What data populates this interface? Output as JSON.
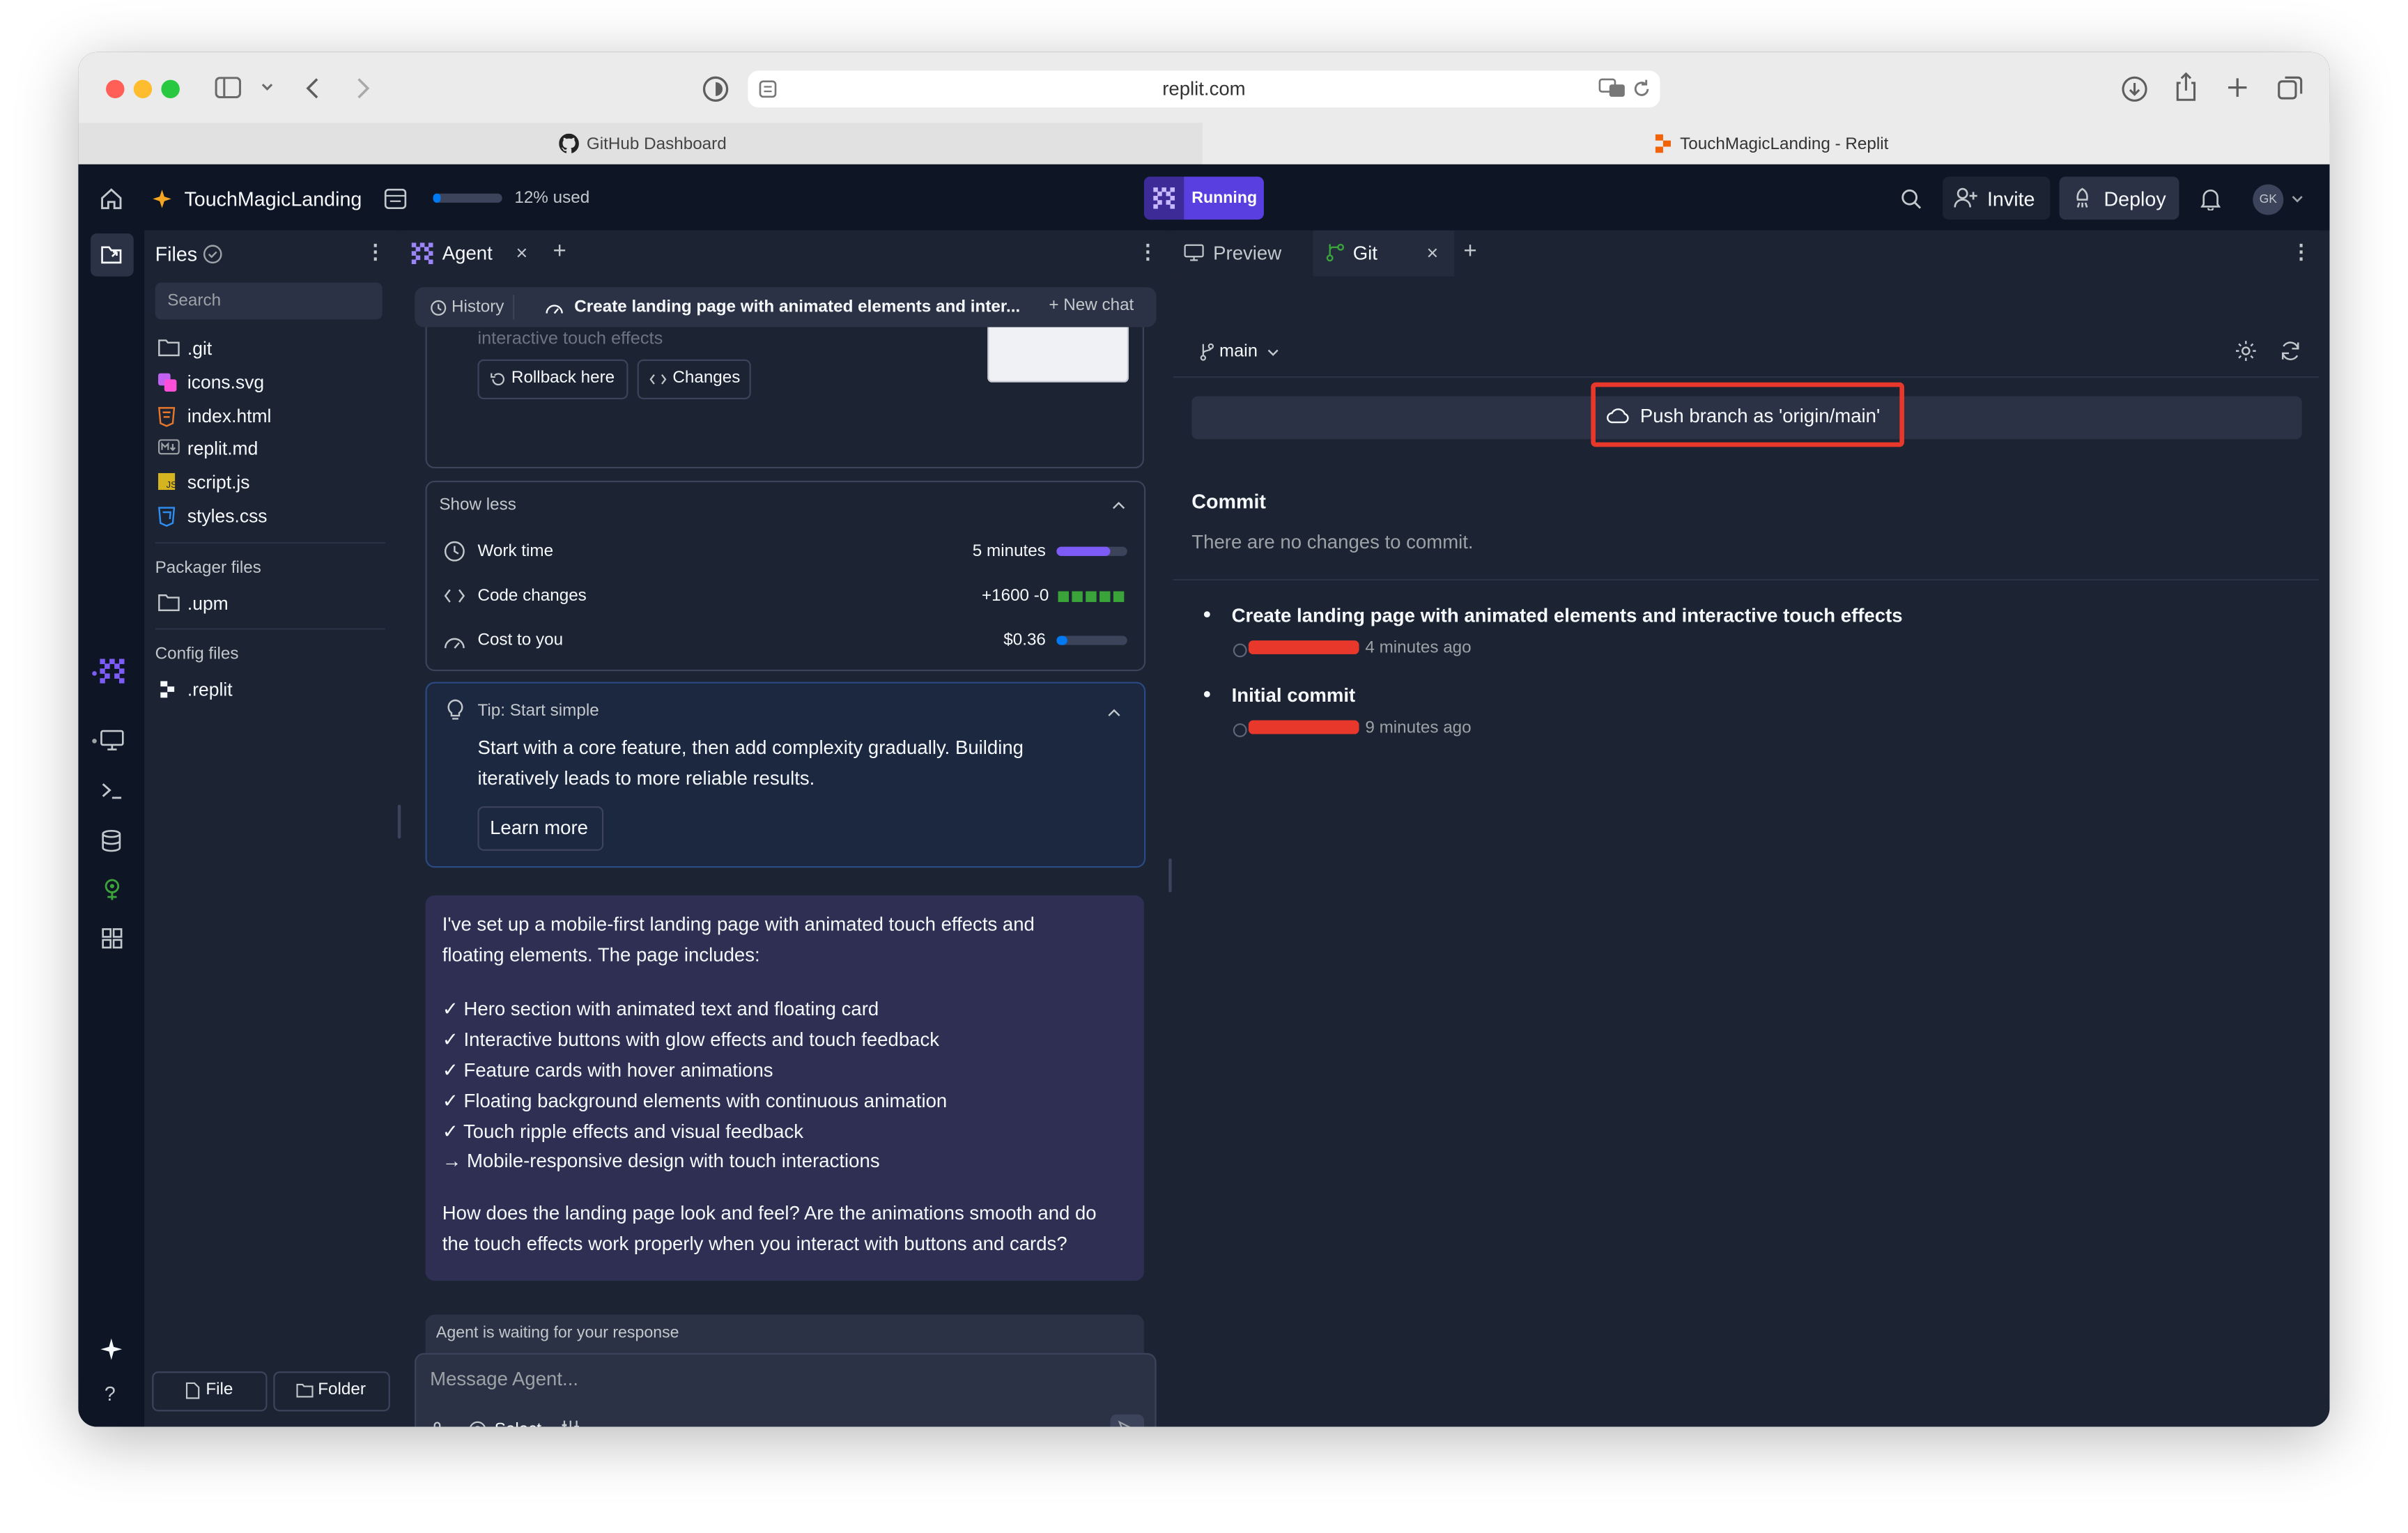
{
  "browser": {
    "url": "replit.com",
    "tabs": [
      {
        "label": "GitHub Dashboard",
        "icon": "github-icon"
      },
      {
        "label": "TouchMagicLanding - Replit",
        "icon": "replit-icon"
      }
    ]
  },
  "topbar": {
    "project_name": "TouchMagicLanding",
    "usage_label": "12% used",
    "usage_fraction": 0.12,
    "run_status": "Running",
    "invite_label": "Invite",
    "deploy_label": "Deploy",
    "avatar_initials": "GK"
  },
  "files": {
    "title": "Files",
    "search_placeholder": "Search",
    "items": [
      {
        "name": ".git",
        "icon": "folder-icon"
      },
      {
        "name": "icons.svg",
        "icon": "svg-file-icon"
      },
      {
        "name": "index.html",
        "icon": "html-file-icon"
      },
      {
        "name": "replit.md",
        "icon": "markdown-file-icon"
      },
      {
        "name": "script.js",
        "icon": "js-file-icon"
      },
      {
        "name": "styles.css",
        "icon": "css-file-icon"
      }
    ],
    "packager_title": "Packager files",
    "packager_items": [
      {
        "name": ".upm",
        "icon": "folder-icon"
      }
    ],
    "config_title": "Config files",
    "config_items": [
      {
        "name": ".replit",
        "icon": "replit-file-icon"
      }
    ],
    "new_file_label": "File",
    "new_folder_label": "Folder"
  },
  "agent": {
    "tab_label": "Agent",
    "history_label": "History",
    "chat_title": "Create landing page with animated elements and inter...",
    "new_chat_label": "New chat",
    "partial_text": "interactive touch effects",
    "rollback_label": "Rollback here",
    "changes_label": "Changes",
    "show_less_label": "Show less",
    "stats": [
      {
        "label": "Work time",
        "value": "5 minutes",
        "icon": "clock-icon",
        "fill": 0.75
      },
      {
        "label": "Code changes",
        "value": "+1600 -0",
        "icon": "code-icon"
      },
      {
        "label": "Cost to you",
        "value": "$0.36",
        "icon": "gauge-icon",
        "fill": 0.15
      }
    ],
    "tip_title": "Tip: Start simple",
    "tip_lines": [
      "Start with a core feature, then add complexity gradually. Building",
      "iteratively leads to more reliable results."
    ],
    "learn_more_label": "Learn more",
    "message_lines": [
      "I've set up a mobile-first landing page with animated touch effects and",
      "floating elements. The page includes:",
      "",
      "✓ Hero section with animated text and floating card",
      "✓ Interactive buttons with glow effects and touch feedback",
      "✓ Feature cards with hover animations",
      "✓ Floating background elements with continuous animation",
      "✓ Touch ripple effects and visual feedback",
      "→ Mobile-responsive design with touch interactions",
      "",
      "How does the landing page look and feel? Are the animations smooth and do",
      "the touch effects work properly when you interact with buttons and cards?"
    ],
    "waiting_label": "Agent is waiting for your response",
    "input_placeholder": "Message Agent...",
    "select_label": "Select"
  },
  "git": {
    "preview_tab_label": "Preview",
    "git_tab_label": "Git",
    "branch_label": "main",
    "push_label": "Push branch as 'origin/main'",
    "commit_heading": "Commit",
    "no_changes_text": "There are no changes to commit.",
    "commits": [
      {
        "message": "Create landing page with animated elements and interactive touch effects",
        "time": "4 minutes ago"
      },
      {
        "message": "Initial commit",
        "time": "9 minutes ago"
      }
    ]
  },
  "colors": {
    "background": "#1c2333",
    "topbar": "#0e1525",
    "accent": "#7d5bf7",
    "running_badge": "#5a3fe0",
    "highlight_outline": "#e8372b",
    "agent_message_bg": "#2e2f53",
    "success_green": "#3aa339"
  }
}
